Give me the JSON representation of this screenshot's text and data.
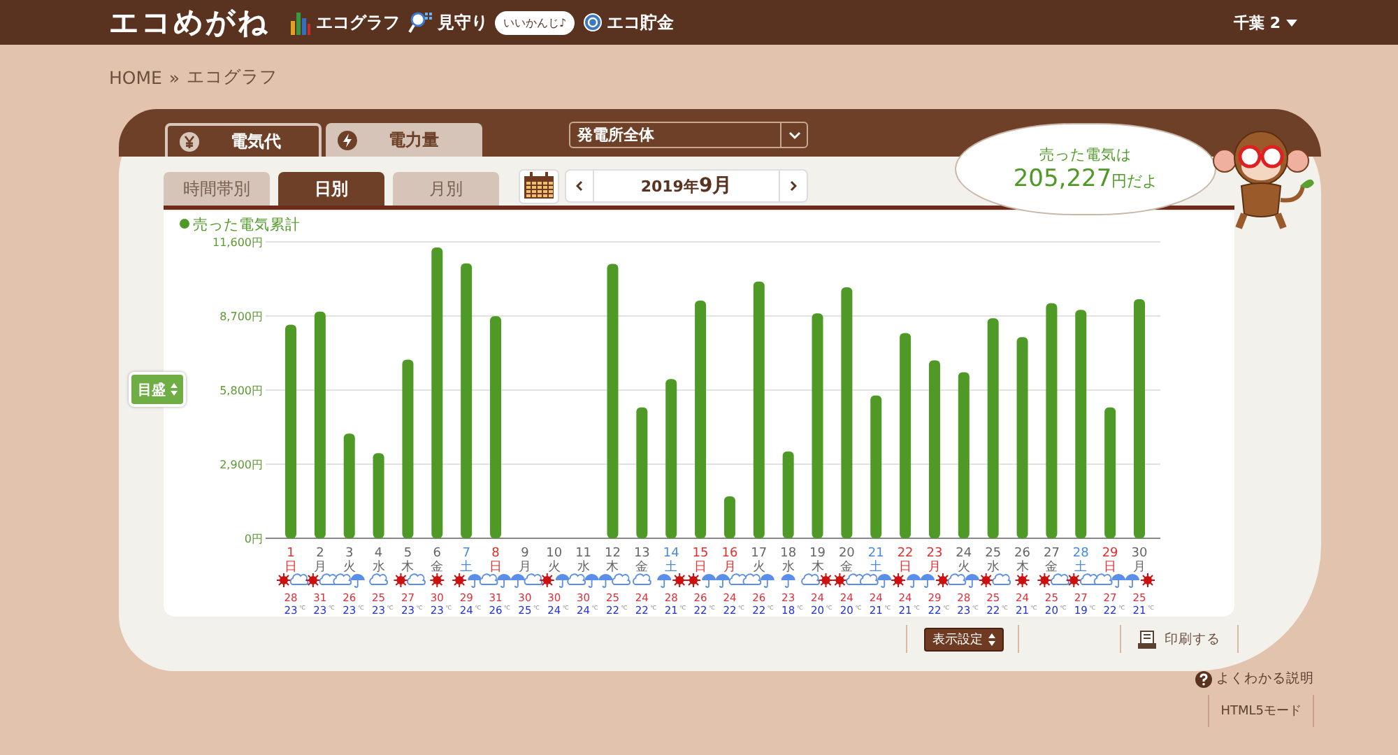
{
  "header": {
    "logo": "エコめがね",
    "nav": [
      {
        "kind": "graph",
        "label": "エコグラフ"
      },
      {
        "kind": "watch",
        "label": "見守り",
        "badge": "いいかんじ♪"
      },
      {
        "kind": "coin",
        "label": "エコ貯金"
      }
    ],
    "user": "千葉 2"
  },
  "breadcrumb": {
    "home": "HOME",
    "separator": "»",
    "current": "エコグラフ"
  },
  "tabs": [
    {
      "kind": "yen",
      "label": "電気代",
      "selected": true
    },
    {
      "kind": "bolt",
      "label": "電力量",
      "selected": false
    }
  ],
  "plant_select": {
    "value": "発電所全体"
  },
  "period_tabs": [
    {
      "label": "時間帯別",
      "selected": false
    },
    {
      "label": "日別",
      "selected": true
    },
    {
      "label": "月別",
      "selected": false
    }
  ],
  "date_nav": {
    "value": "2019年**9月**"
  },
  "bubble": {
    "title": "売った電気は",
    "amount": "**205,227**円だよ"
  },
  "scale_button": "目盛",
  "chart_data": {
    "type": "bar",
    "grid": true,
    "categories": [
      "1",
      "2",
      "3",
      "4",
      "5",
      "6",
      "7",
      "8",
      "9",
      "10",
      "11",
      "12",
      "13",
      "14",
      "15",
      "16",
      "17",
      "18",
      "19",
      "20",
      "21",
      "22",
      "23",
      "24",
      "25",
      "26",
      "27",
      "28",
      "29",
      "30"
    ],
    "series": [
      {
        "name": "売った電気累計",
        "color": "#4f9a26",
        "values": [
          8360,
          8870,
          4100,
          3330,
          6990,
          11380,
          10760,
          8690,
          0,
          0,
          0,
          10740,
          5120,
          6230,
          9300,
          1640,
          10050,
          3400,
          8800,
          9820,
          5590,
          8030,
          6960,
          6500,
          8610,
          7870,
          9200,
          8940,
          5120,
          9360
        ]
      }
    ],
    "ylim": [
      0,
      11600
    ],
    "yticks": [
      {
        "value": 0,
        "label": "0円"
      },
      {
        "value": 2900,
        "label": "2,900円"
      },
      {
        "value": 5800,
        "label": "5,800円"
      },
      {
        "value": 8700,
        "label": "8,700円"
      },
      {
        "value": 11600,
        "label": "11,600円"
      }
    ]
  },
  "days": [
    {
      "weekday": "日",
      "kind": "holiday",
      "weather": [
        {
          "kind": "sun"
        },
        {
          "kind": "cloud"
        }
      ],
      "high": "28",
      "low": "23",
      "unit": "℃"
    },
    {
      "weekday": "月",
      "kind": "weekday",
      "weather": [
        {
          "kind": "sun"
        },
        {
          "kind": "cloud"
        }
      ],
      "high": "31",
      "low": "23",
      "unit": "℃"
    },
    {
      "weekday": "火",
      "kind": "weekday",
      "weather": [
        {
          "kind": "cloud"
        },
        {
          "kind": "umbrella"
        }
      ],
      "high": "26",
      "low": "23",
      "unit": "℃"
    },
    {
      "weekday": "水",
      "kind": "weekday",
      "weather": [
        {
          "kind": "cloud"
        }
      ],
      "high": "25",
      "low": "23",
      "unit": "℃"
    },
    {
      "weekday": "木",
      "kind": "weekday",
      "weather": [
        {
          "kind": "sun"
        },
        {
          "kind": "cloud"
        }
      ],
      "high": "27",
      "low": "23",
      "unit": "℃"
    },
    {
      "weekday": "金",
      "kind": "weekday",
      "weather": [
        {
          "kind": "sun"
        }
      ],
      "high": "30",
      "low": "23",
      "unit": "℃"
    },
    {
      "weekday": "土",
      "kind": "saturday",
      "weather": [
        {
          "kind": "sun"
        },
        {
          "kind": "umbrella"
        }
      ],
      "high": "29",
      "low": "24",
      "unit": "℃"
    },
    {
      "weekday": "日",
      "kind": "holiday",
      "weather": [
        {
          "kind": "cloud"
        },
        {
          "kind": "umbrella"
        }
      ],
      "high": "31",
      "low": "26",
      "unit": "℃"
    },
    {
      "weekday": "月",
      "kind": "weekday",
      "weather": [
        {
          "kind": "umbrella"
        },
        {
          "kind": "cloud"
        }
      ],
      "high": "30",
      "low": "25",
      "unit": "℃"
    },
    {
      "weekday": "火",
      "kind": "weekday",
      "weather": [
        {
          "kind": "sun"
        },
        {
          "kind": "umbrella"
        }
      ],
      "high": "30",
      "low": "24",
      "unit": "℃"
    },
    {
      "weekday": "水",
      "kind": "weekday",
      "weather": [
        {
          "kind": "cloud"
        },
        {
          "kind": "umbrella"
        }
      ],
      "high": "30",
      "low": "24",
      "unit": "℃"
    },
    {
      "weekday": "木",
      "kind": "weekday",
      "weather": [
        {
          "kind": "umbrella"
        },
        {
          "kind": "cloud"
        }
      ],
      "high": "25",
      "low": "22",
      "unit": "℃"
    },
    {
      "weekday": "金",
      "kind": "weekday",
      "weather": [
        {
          "kind": "cloud"
        }
      ],
      "high": "24",
      "low": "22",
      "unit": "℃"
    },
    {
      "weekday": "土",
      "kind": "saturday",
      "weather": [
        {
          "kind": "umbrella"
        },
        {
          "kind": "sun"
        }
      ],
      "high": "28",
      "low": "21",
      "unit": "℃"
    },
    {
      "weekday": "日",
      "kind": "holiday",
      "weather": [
        {
          "kind": "sun"
        },
        {
          "kind": "umbrella"
        }
      ],
      "high": "26",
      "low": "22",
      "unit": "℃"
    },
    {
      "weekday": "月",
      "kind": "holiday",
      "weather": [
        {
          "kind": "umbrella"
        },
        {
          "kind": "cloud"
        }
      ],
      "high": "24",
      "low": "22",
      "unit": "℃"
    },
    {
      "weekday": "火",
      "kind": "weekday",
      "weather": [
        {
          "kind": "cloud"
        },
        {
          "kind": "umbrella"
        }
      ],
      "high": "26",
      "low": "22",
      "unit": "℃"
    },
    {
      "weekday": "水",
      "kind": "weekday",
      "weather": [
        {
          "kind": "umbrella"
        }
      ],
      "high": "23",
      "low": "18",
      "unit": "℃"
    },
    {
      "weekday": "木",
      "kind": "weekday",
      "weather": [
        {
          "kind": "cloud"
        },
        {
          "kind": "sun"
        }
      ],
      "high": "24",
      "low": "20",
      "unit": "℃"
    },
    {
      "weekday": "金",
      "kind": "weekday",
      "weather": [
        {
          "kind": "sun"
        },
        {
          "kind": "cloud"
        }
      ],
      "high": "24",
      "low": "20",
      "unit": "℃"
    },
    {
      "weekday": "土",
      "kind": "saturday",
      "weather": [
        {
          "kind": "cloud"
        },
        {
          "kind": "umbrella"
        }
      ],
      "high": "24",
      "low": "21",
      "unit": "℃"
    },
    {
      "weekday": "日",
      "kind": "holiday",
      "weather": [
        {
          "kind": "sun"
        },
        {
          "kind": "umbrella"
        }
      ],
      "high": "24",
      "low": "21",
      "unit": "℃"
    },
    {
      "weekday": "月",
      "kind": "holiday",
      "weather": [
        {
          "kind": "umbrella"
        },
        {
          "kind": "sun"
        }
      ],
      "high": "29",
      "low": "22",
      "unit": "℃"
    },
    {
      "weekday": "火",
      "kind": "weekday",
      "weather": [
        {
          "kind": "cloud"
        },
        {
          "kind": "umbrella"
        }
      ],
      "high": "28",
      "low": "23",
      "unit": "℃"
    },
    {
      "weekday": "水",
      "kind": "weekday",
      "weather": [
        {
          "kind": "sun"
        },
        {
          "kind": "cloud"
        }
      ],
      "high": "25",
      "low": "22",
      "unit": "℃"
    },
    {
      "weekday": "木",
      "kind": "weekday",
      "weather": [
        {
          "kind": "sun"
        }
      ],
      "high": "24",
      "low": "21",
      "unit": "℃"
    },
    {
      "weekday": "金",
      "kind": "weekday",
      "weather": [
        {
          "kind": "sun"
        },
        {
          "kind": "cloud"
        }
      ],
      "high": "25",
      "low": "20",
      "unit": "℃"
    },
    {
      "weekday": "土",
      "kind": "saturday",
      "weather": [
        {
          "kind": "sun"
        },
        {
          "kind": "cloud"
        }
      ],
      "high": "27",
      "low": "19",
      "unit": "℃"
    },
    {
      "weekday": "日",
      "kind": "holiday",
      "weather": [
        {
          "kind": "cloud"
        },
        {
          "kind": "umbrella"
        }
      ],
      "high": "27",
      "low": "22",
      "unit": "℃"
    },
    {
      "weekday": "月",
      "kind": "weekday",
      "weather": [
        {
          "kind": "umbrella"
        },
        {
          "kind": "sun"
        }
      ],
      "high": "25",
      "low": "21",
      "unit": "℃"
    }
  ],
  "toolbar": {
    "display_settings": "表示設定",
    "print": "印刷する"
  },
  "footer": {
    "help": "よくわかる説明",
    "html5": "HTML5モード"
  }
}
